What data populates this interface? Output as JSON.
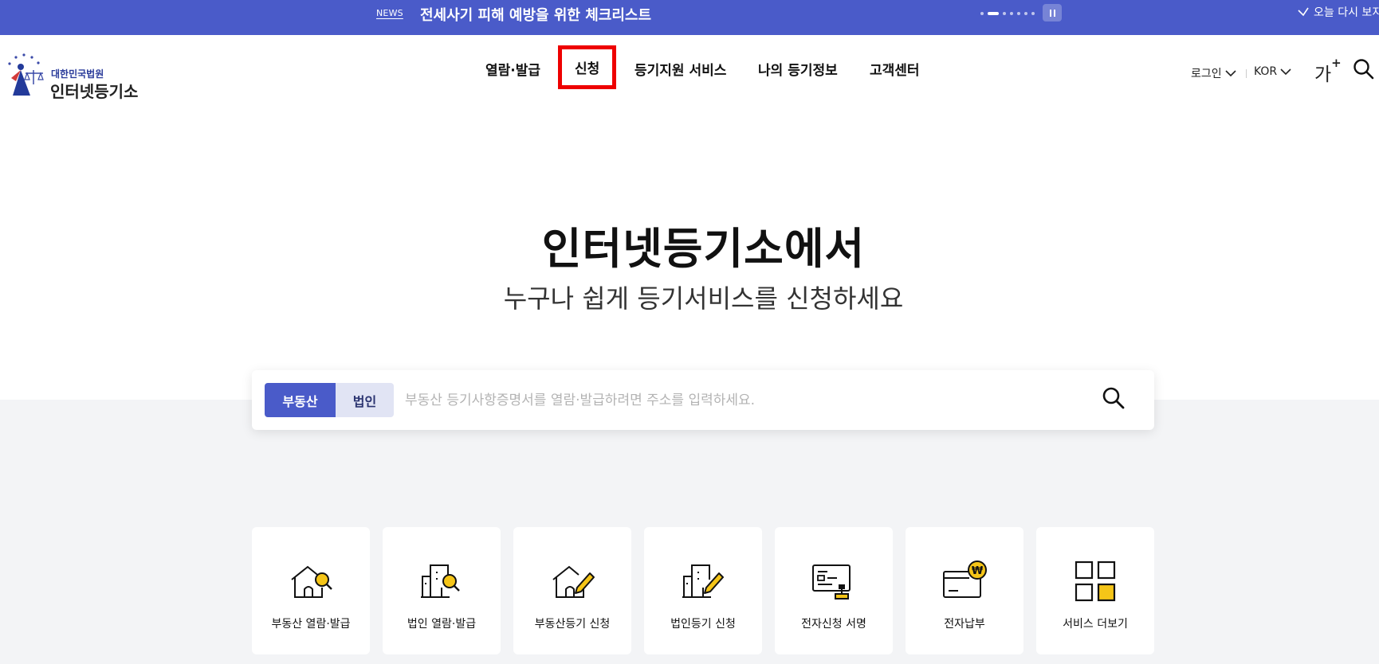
{
  "news": {
    "tag": "NEWS",
    "headline": "전세사기 피해 예방을 위한 체크리스트",
    "dismiss_label": "오늘 다시 보지"
  },
  "header": {
    "logo_sub": "대한민국법원",
    "logo_main": "인터넷등기소",
    "nav": [
      {
        "label": "열람·발급"
      },
      {
        "label": "신청"
      },
      {
        "label": "등기지원 서비스"
      },
      {
        "label": "나의 등기정보"
      },
      {
        "label": "고객센터"
      }
    ],
    "login_label": "로그인",
    "lang_label": "KOR",
    "font_label": "가",
    "font_plus": "+"
  },
  "hero": {
    "title": "인터넷등기소에서",
    "subtitle": "누구나 쉽게 등기서비스를 신청하세요"
  },
  "search": {
    "tabs": [
      {
        "label": "부동산"
      },
      {
        "label": "법인"
      }
    ],
    "placeholder": "부동산 등기사항증명서를 열람·발급하려면 주소를 입력하세요."
  },
  "services": [
    {
      "label": "부동산 열람·발급",
      "icon": "house-search-icon"
    },
    {
      "label": "법인 열람·발급",
      "icon": "building-search-icon"
    },
    {
      "label": "부동산등기 신청",
      "icon": "house-pen-icon"
    },
    {
      "label": "법인등기 신청",
      "icon": "building-pen-icon"
    },
    {
      "label": "전자신청 서명",
      "icon": "e-signature-icon"
    },
    {
      "label": "전자납부",
      "icon": "e-payment-icon"
    },
    {
      "label": "서비스 더보기",
      "icon": "grid-more-icon"
    }
  ],
  "colors": {
    "primary": "#4a5bc9",
    "accent_yellow": "#f5c518",
    "highlight_red": "#ee0000"
  }
}
